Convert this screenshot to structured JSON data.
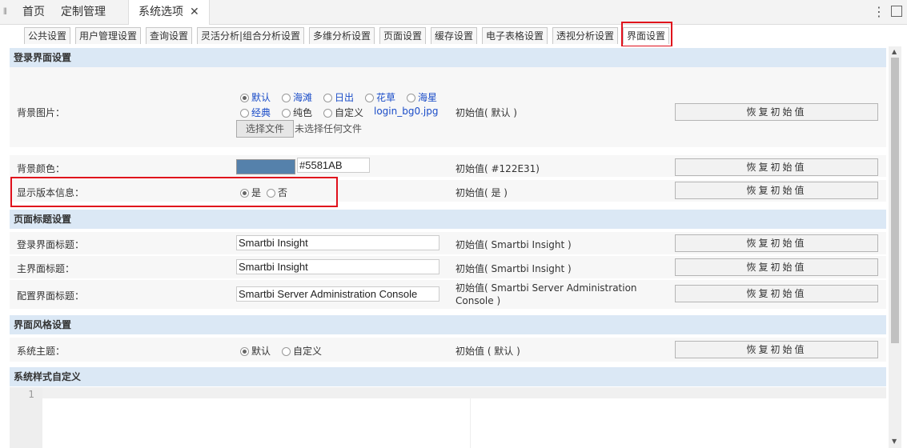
{
  "topbar": {
    "grip": "⦀",
    "tabs": [
      "首页",
      "定制管理",
      "系统选项"
    ],
    "close": "✕",
    "more": "⋮"
  },
  "subtabs": [
    "公共设置",
    "用户管理设置",
    "查询设置",
    "灵活分析|组合分析设置",
    "多维分析设置",
    "页面设置",
    "缓存设置",
    "电子表格设置",
    "透视分析设置",
    "界面设置"
  ],
  "sections": {
    "login": "登录界面设置",
    "title": "页面标题设置",
    "style": "界面风格设置",
    "custom": "系统样式自定义"
  },
  "reset_label": "恢复初始值",
  "bg_image": {
    "label": "背景图片：",
    "options": [
      "默认",
      "海滩",
      "日出",
      "花草",
      "海星",
      "经典",
      "纯色",
      "自定义"
    ],
    "file_name": "login_bg0.jpg",
    "file_button": "选择文件",
    "file_status": "未选择任何文件",
    "init": "初始值( 默认 )"
  },
  "bg_color": {
    "label": "背景颜色：",
    "value": "#5581AB",
    "swatch": "#5581AB",
    "init": "初始值( #122E31)"
  },
  "version": {
    "label": "显示版本信息：",
    "yes": "是",
    "no": "否",
    "init": "初始值( 是 )"
  },
  "titles": [
    {
      "label": "登录界面标题：",
      "value": "Smartbi Insight",
      "init": "初始值( Smartbi Insight )"
    },
    {
      "label": "主界面标题：",
      "value": "Smartbi Insight",
      "init": "初始值( Smartbi Insight )"
    },
    {
      "label": "配置界面标题：",
      "value": "Smartbi Server Administration Console",
      "init": "初始值( Smartbi Server Administration Console )"
    }
  ],
  "theme": {
    "label": "系统主题：",
    "opt1": "默认",
    "opt2": "自定义",
    "init": "初始值 ( 默认 )"
  },
  "editor": {
    "line_number": "1"
  }
}
